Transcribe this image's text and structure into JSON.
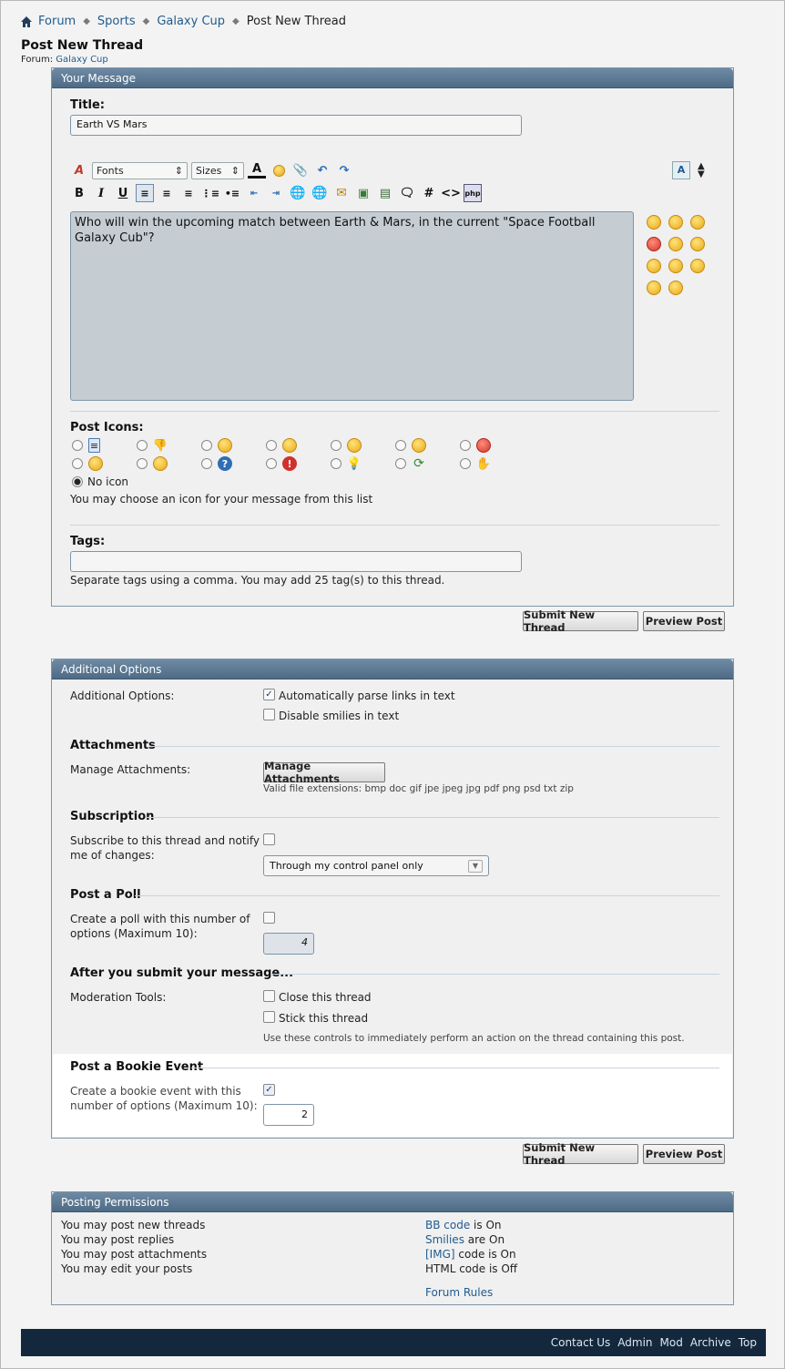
{
  "breadcrumb": {
    "items": [
      "Forum",
      "Sports",
      "Galaxy Cup",
      "Post New Thread"
    ]
  },
  "page": {
    "title": "Post New Thread",
    "forum_prefix": "Forum:",
    "forum_name": "Galaxy Cup"
  },
  "your_message": {
    "header": "Your Message",
    "title_label": "Title:",
    "title_value": "Earth VS Mars",
    "toolbar": {
      "fonts": "Fonts",
      "sizes": "Sizes"
    },
    "message": "Who will win the upcoming match between Earth & Mars, in the current \"Space Football Galaxy Cub\"?",
    "post_icons_label": "Post Icons:",
    "no_icon": "No icon",
    "icons_hint": "You may choose an icon for your message from this list",
    "tags_label": "Tags:",
    "tags_value": "",
    "tags_hint": "Separate tags using a comma. You may add 25 tag(s) to this thread."
  },
  "buttons": {
    "submit": "Submit New Thread",
    "preview": "Preview Post"
  },
  "additional": {
    "header": "Additional Options",
    "options_label": "Additional Options:",
    "opt_parse_links": "Automatically parse links in text",
    "opt_disable_smilies": "Disable smilies in text",
    "attachments_heading": "Attachments",
    "manage_label": "Manage Attachments:",
    "manage_button": "Manage Attachments",
    "extensions": "Valid file extensions: bmp doc gif jpe jpeg jpg pdf png psd txt zip",
    "subscription_heading": "Subscription",
    "subscribe_label_1": "Subscribe to this thread and notify",
    "subscribe_label_2": "me of changes:",
    "subscribe_select": "Through my control panel only",
    "poll_heading": "Post a Poll",
    "poll_label_1": "Create a poll with this number of",
    "poll_label_2": "options (Maximum 10):",
    "poll_value": "4",
    "after_heading": "After you submit your message...",
    "moderation_label": "Moderation Tools:",
    "close_thread": "Close this thread",
    "stick_thread": "Stick this thread",
    "moderation_hint": "Use these controls to immediately perform an action on the thread containing this post.",
    "bookie_heading": "Post a Bookie Event",
    "bookie_label_1": "Create a bookie event with this",
    "bookie_label_2": "number of options (Maximum 10):",
    "bookie_value": "2"
  },
  "permissions": {
    "header": "Posting Permissions",
    "left": [
      "You may post new threads",
      "You may post replies",
      "You may post attachments",
      "You may edit your posts"
    ],
    "bb_code": "BB code",
    "bb_state": "is On",
    "smilies": "Smilies",
    "smilies_state": "are On",
    "img": "[IMG]",
    "img_state": "code is On",
    "html": "HTML code is Off",
    "rules": "Forum Rules"
  },
  "footer": {
    "links": [
      "Contact Us",
      "Admin",
      "Mod",
      "Archive",
      "Top"
    ]
  },
  "colors": {
    "accent": "#1f5b8e",
    "panel_header": "#5d7a94",
    "footer": "#14283d"
  }
}
